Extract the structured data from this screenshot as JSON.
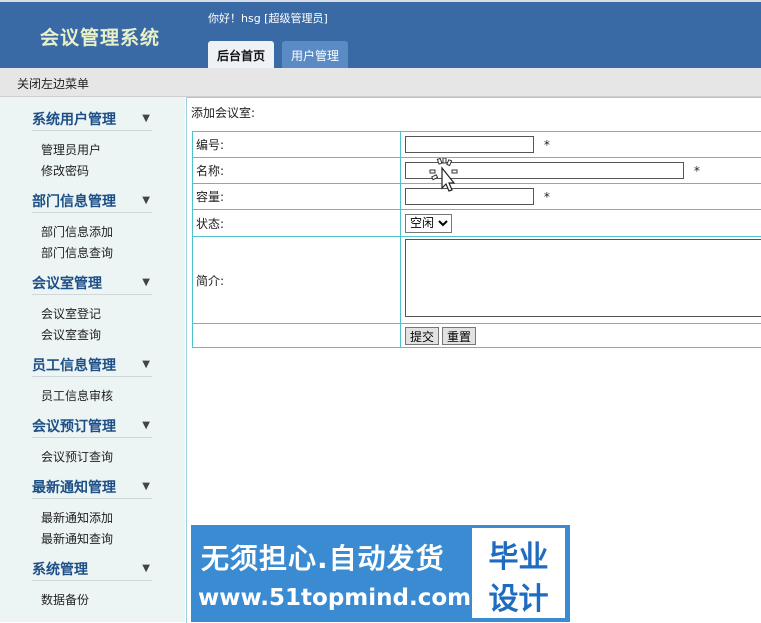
{
  "header": {
    "app_title": "会议管理系统",
    "greeting": "你好！hsg [超级管理员]",
    "tabs": [
      {
        "label": "后台首页",
        "active": true
      },
      {
        "label": "用户管理",
        "active": false
      }
    ]
  },
  "toolbar": {
    "toggle_menu": "关闭左边菜单"
  },
  "sidebar": {
    "groups": [
      {
        "title": "系统用户管理",
        "items": [
          "管理员用户",
          "修改密码"
        ]
      },
      {
        "title": "部门信息管理",
        "items": [
          "部门信息添加",
          "部门信息查询"
        ]
      },
      {
        "title": "会议室管理",
        "items": [
          "会议室登记",
          "会议室查询"
        ]
      },
      {
        "title": "员工信息管理",
        "items": [
          "员工信息审核"
        ]
      },
      {
        "title": "会议预订管理",
        "items": [
          "会议预订查询"
        ]
      },
      {
        "title": "最新通知管理",
        "items": [
          "最新通知添加",
          "最新通知查询"
        ]
      },
      {
        "title": "系统管理",
        "items": [
          "数据备份"
        ]
      }
    ]
  },
  "form": {
    "page_title": "添加会议室:",
    "fields": {
      "code": {
        "label": "编号:",
        "value": "",
        "required_mark": "*"
      },
      "name": {
        "label": "名称:",
        "value": "",
        "required_mark": "*"
      },
      "capacity": {
        "label": "容量:",
        "value": "",
        "required_mark": "*"
      },
      "status": {
        "label": "状态:",
        "selected": "空闲"
      },
      "intro": {
        "label": "简介:",
        "value": ""
      }
    },
    "buttons": {
      "submit": "提交",
      "reset": "重置"
    }
  },
  "banner": {
    "line1": "无须担心.自动发货",
    "line2": "www.51topmind.com",
    "box_top": "毕业",
    "box_bottom": "设计"
  },
  "colors": {
    "header_bg": "#3a6aa6",
    "sidebar_bg": "#ecf4f4",
    "group_title": "#1d4f86",
    "table_border": "#52c1cf",
    "banner_bg": "#3b8bd2"
  }
}
